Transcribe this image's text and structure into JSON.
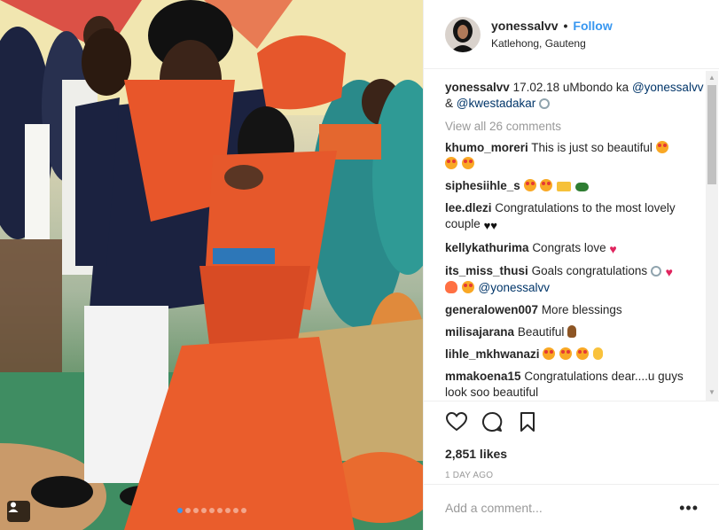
{
  "post": {
    "username": "yonessalvv",
    "follow_label": "Follow",
    "separator": "•",
    "location": "Katlehong, Gauteng",
    "caption": {
      "date_text": "17.02.18 uMbondo ka",
      "mention_1": "@yonessalvv",
      "joiner": "&",
      "mention_2": "@kwestadakar"
    },
    "view_all": "View all 26 comments",
    "comments": [
      {
        "user": "khumo_moreri",
        "text": "This is just so beautiful"
      },
      {
        "user": "siphesiihle_s",
        "text": ""
      },
      {
        "user": "lee.dlezi",
        "text": "Congratulations to the most lovely couple"
      },
      {
        "user": "kellykathurima",
        "text": "Congrats love"
      },
      {
        "user": "its_miss_thusi",
        "text": "Goals congratulations",
        "mention": "@yonessalvv"
      },
      {
        "user": "generalowen007",
        "text": "More blessings"
      },
      {
        "user": "milisajarana",
        "text": "Beautiful"
      },
      {
        "user": "lihle_mkhwanazi",
        "text": ""
      },
      {
        "user": "mmakoena15",
        "text": "Congratulations dear....u guys look soo beautiful"
      }
    ],
    "likes": "2,851 likes",
    "time": "1 DAY AGO",
    "add_comment_placeholder": "Add a comment...",
    "more_label": "•••",
    "carousel": {
      "count": 9,
      "active_index": 0
    }
  },
  "icons": {
    "like": "heart-outline-icon",
    "comment": "speech-bubble-icon",
    "save": "bookmark-icon",
    "tagged": "user-tag-icon"
  },
  "colors": {
    "accent": "#3897f0",
    "text": "#262626",
    "muted": "#999999",
    "border": "#efefef"
  }
}
